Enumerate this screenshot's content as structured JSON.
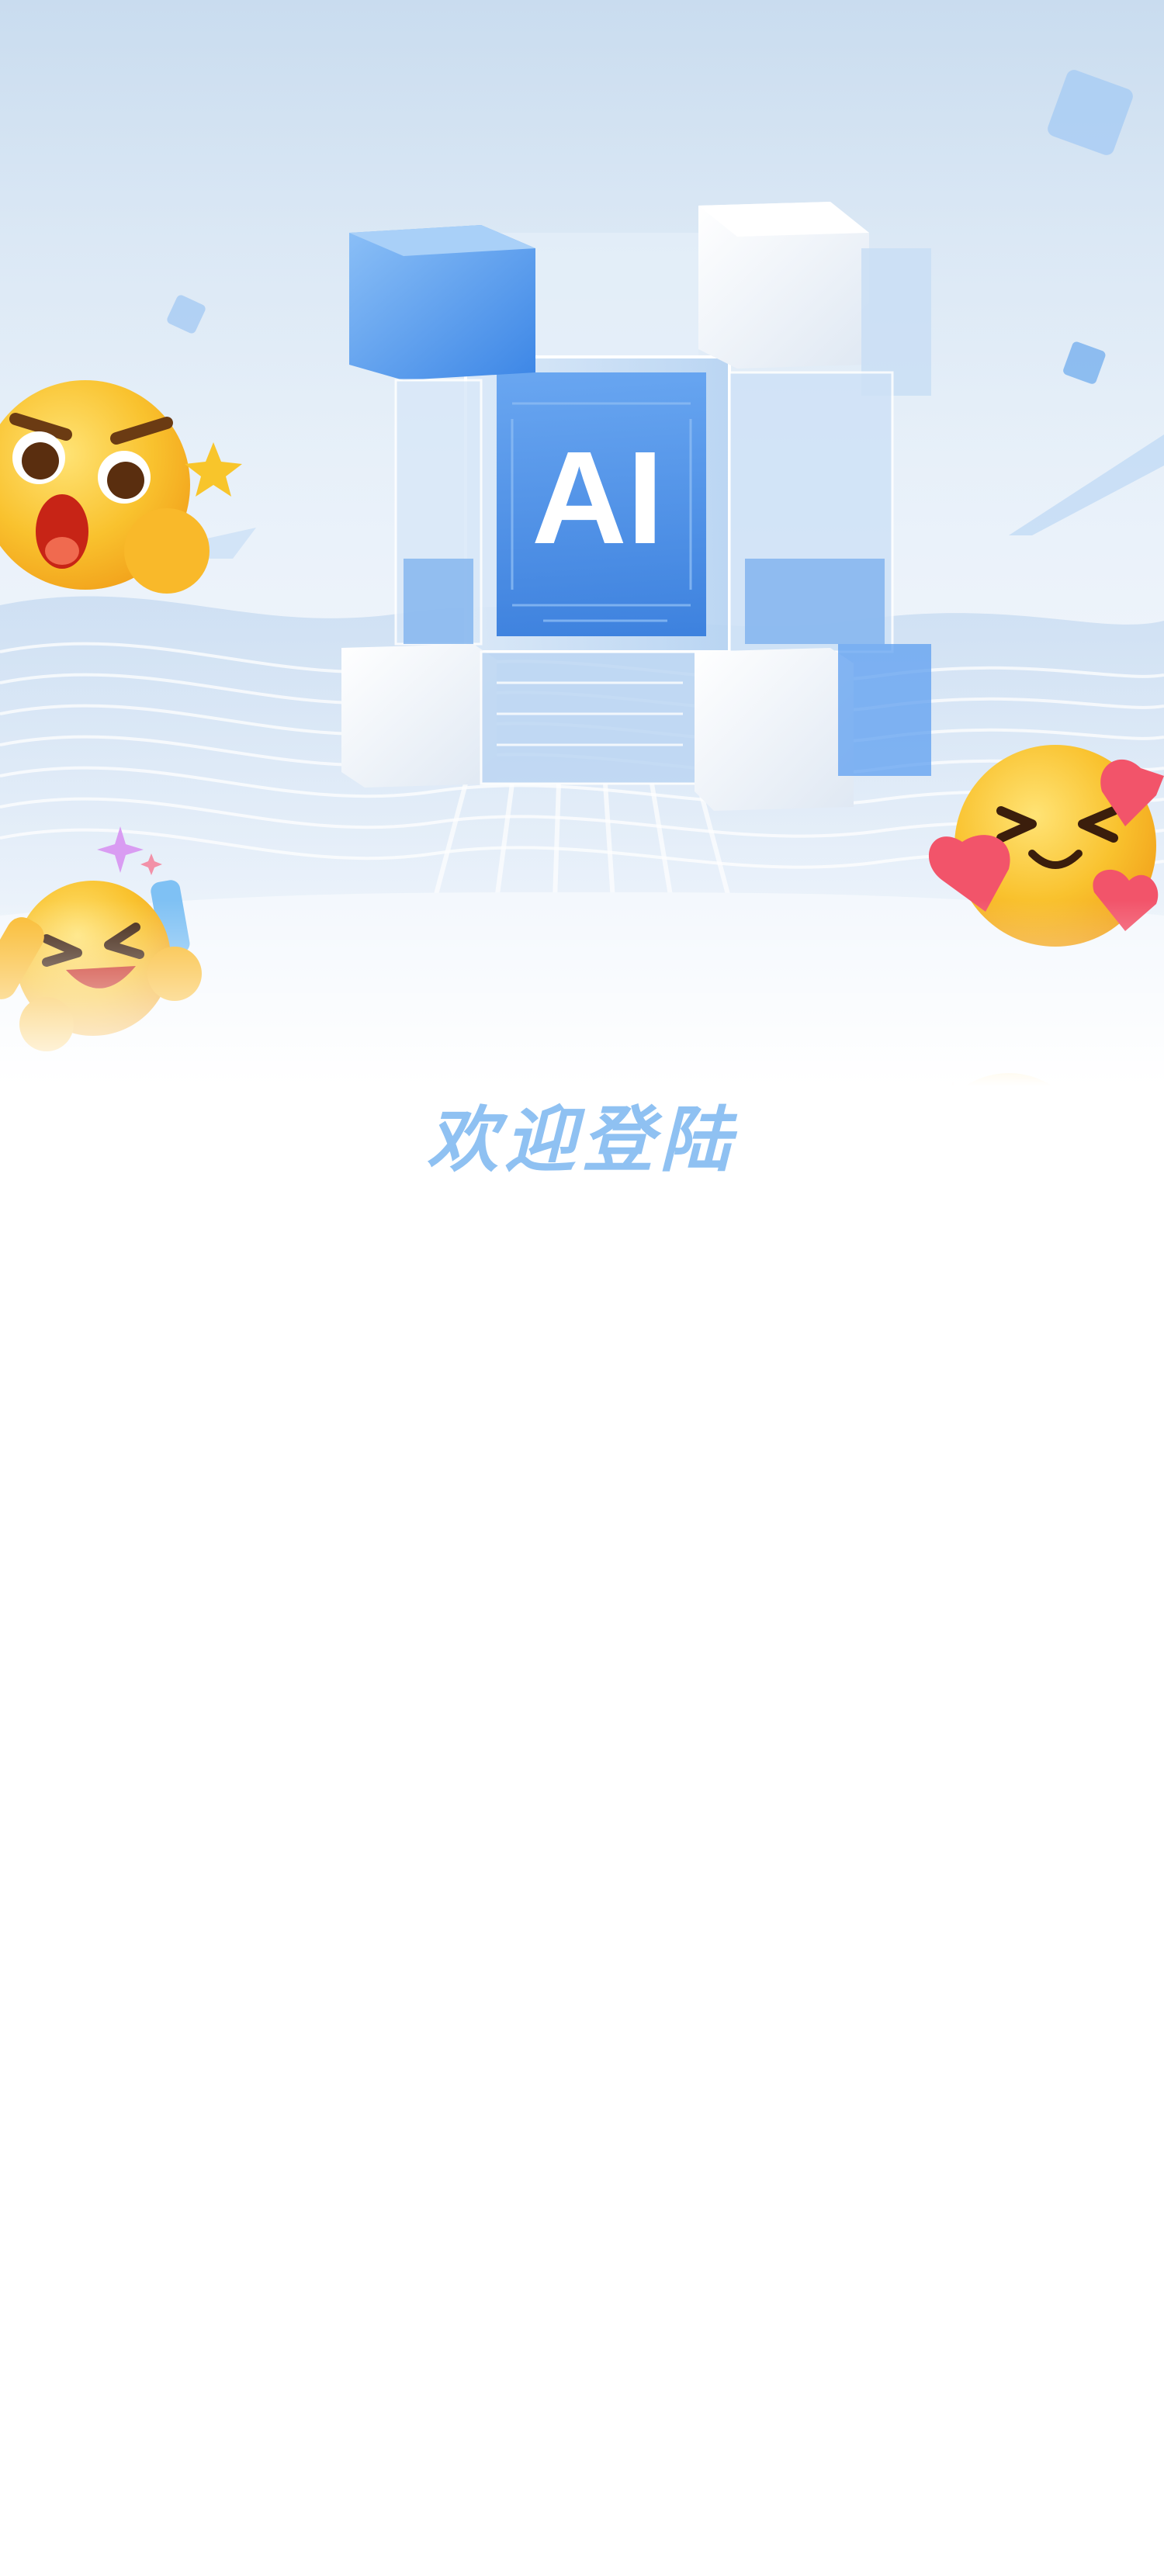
{
  "hero": {
    "cube_label": "AI"
  },
  "login": {
    "welcome_title": "欢迎登陆"
  },
  "colors": {
    "accent": "#8fc1f2",
    "cube_blue": "#3f8ae8",
    "emoji_yellow": "#f9c22e",
    "heart_red": "#f2546a"
  },
  "decorations": [
    "surprised-emoji-icon",
    "laughing-emoji-icon",
    "hearts-emoji-icon",
    "smiling-emoji-icon",
    "sparkle-star-icon"
  ]
}
